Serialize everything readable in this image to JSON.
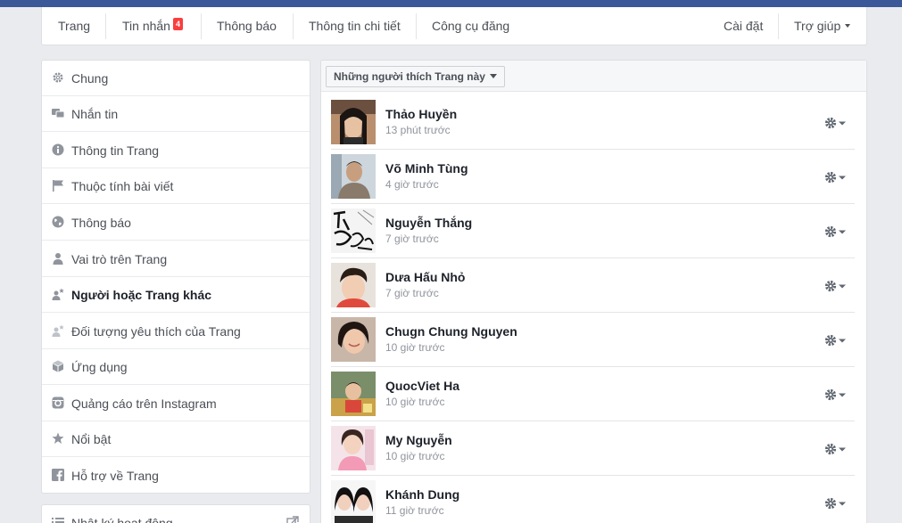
{
  "tabs": {
    "page": "Trang",
    "messages": "Tin nhắn",
    "messages_badge": "4",
    "notifications": "Thông báo",
    "insights": "Thông tin chi tiết",
    "publishing_tools": "Công cụ đăng",
    "settings": "Cài đặt",
    "help": "Trợ giúp"
  },
  "sidebar": {
    "items": [
      {
        "label": "Chung",
        "icon": "gear-icon"
      },
      {
        "label": "Nhắn tin",
        "icon": "message-icon"
      },
      {
        "label": "Thông tin Trang",
        "icon": "info-icon"
      },
      {
        "label": "Thuộc tính bài viết",
        "icon": "flag-icon"
      },
      {
        "label": "Thông báo",
        "icon": "globe-icon"
      },
      {
        "label": "Vai trò trên Trang",
        "icon": "person-icon"
      },
      {
        "label": "Người hoặc Trang khác",
        "icon": "person-star-icon",
        "active": true
      },
      {
        "label": "Đối tượng yêu thích của Trang",
        "icon": "person-star-icon"
      },
      {
        "label": "Ứng dụng",
        "icon": "cube-icon"
      },
      {
        "label": "Quảng cáo trên Instagram",
        "icon": "instagram-icon"
      },
      {
        "label": "Nổi bật",
        "icon": "star-icon"
      },
      {
        "label": "Hỗ trợ về Trang",
        "icon": "facebook-icon"
      }
    ],
    "activity_log": "Nhật ký hoạt động"
  },
  "main": {
    "filter_label": "Những người thích Trang này",
    "people": [
      {
        "name": "Thảo Huyền",
        "time": "13 phút trước"
      },
      {
        "name": "Võ Minh Tùng",
        "time": "4 giờ trước"
      },
      {
        "name": "Nguyễn Thắng",
        "time": "7 giờ trước"
      },
      {
        "name": "Dưa Hấu Nhỏ",
        "time": "7 giờ trước"
      },
      {
        "name": "Chugn Chung Nguyen",
        "time": "10 giờ trước"
      },
      {
        "name": "QuocViet Ha",
        "time": "10 giờ trước"
      },
      {
        "name": "My Nguyễn",
        "time": "10 giờ trước"
      },
      {
        "name": "Khánh Dung",
        "time": "11 giờ trước"
      }
    ]
  },
  "colors": {
    "brand": "#3b5998",
    "background": "#e9ebee",
    "badge": "#fa3e3e",
    "text": "#4b4f56",
    "muted": "#90949c"
  }
}
